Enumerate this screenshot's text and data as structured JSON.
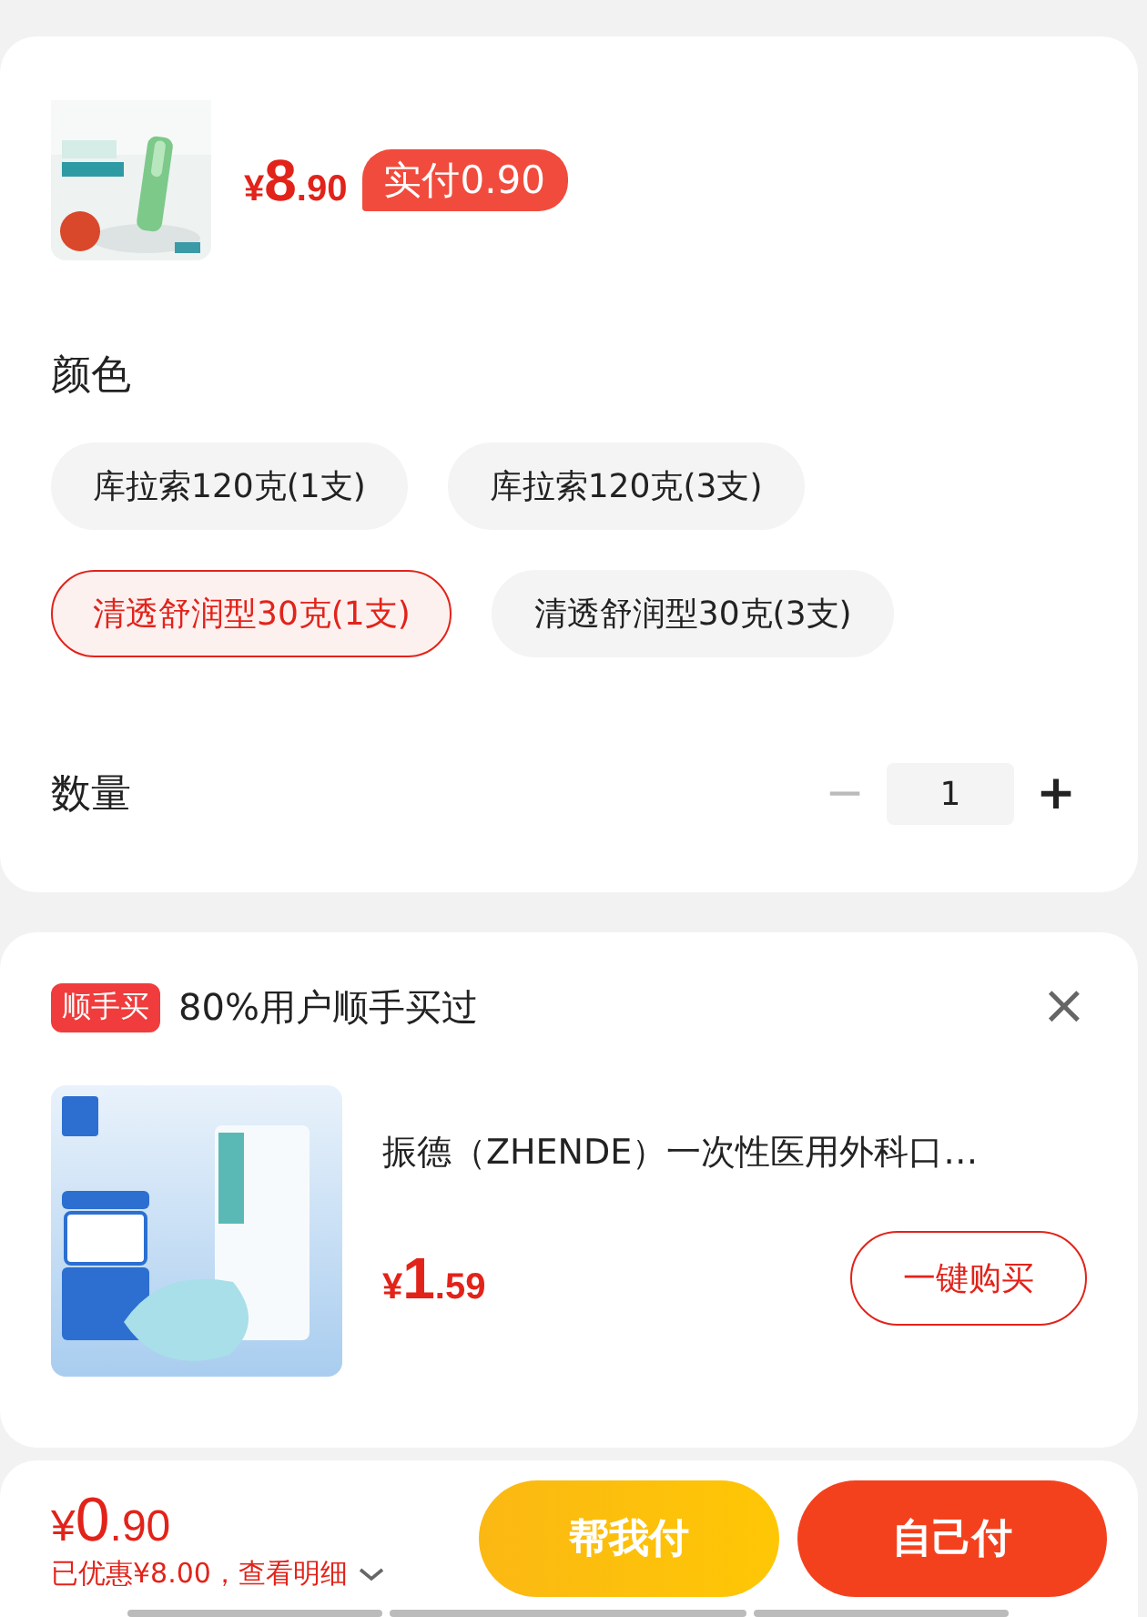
{
  "product": {
    "price": {
      "currency": "¥",
      "integer": "8",
      "decimal": ".90"
    },
    "pay_tag": "实付0.90"
  },
  "color_section": {
    "label": "颜色",
    "options": [
      {
        "label": "库拉索120克(1支)",
        "selected": false
      },
      {
        "label": "库拉索120克(3支)",
        "selected": false
      },
      {
        "label": "清透舒润型30克(1支)",
        "selected": true
      },
      {
        "label": "清透舒润型30克(3支)",
        "selected": false
      }
    ]
  },
  "quantity": {
    "label": "数量",
    "minus": "−",
    "value": "1",
    "plus": "+",
    "minus_disabled": true
  },
  "add_on": {
    "tag": "顺手买",
    "title": "80%用户顺手买过",
    "close": "×",
    "item": {
      "title": "振德（ZHENDE）一次性医用外科口…",
      "price": {
        "currency": "¥",
        "integer": "1",
        "decimal": ".59"
      },
      "button": "一键购买"
    }
  },
  "footer": {
    "total": {
      "currency": "¥",
      "integer": "0",
      "decimal": ".90"
    },
    "saving": "已优惠¥8.00，查看明细",
    "buttons": [
      {
        "label": "帮我付",
        "kind": "help"
      },
      {
        "label": "自己付",
        "kind": "self"
      }
    ]
  }
}
